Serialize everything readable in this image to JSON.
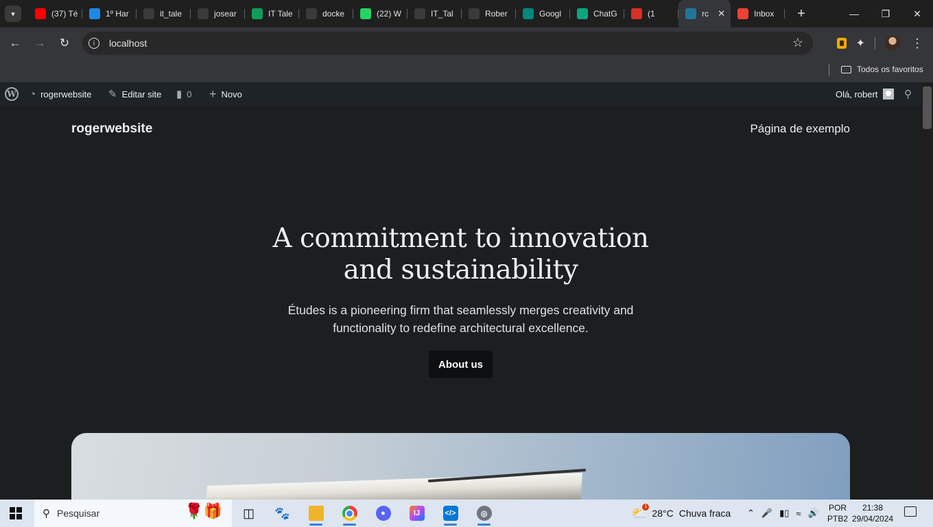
{
  "browser": {
    "tabs": [
      {
        "title": "(37) Té",
        "icon": "youtube-icon",
        "color": "#ff0000"
      },
      {
        "title": "1º Har",
        "icon": "google-classroom-icon",
        "color": "#1e88e5"
      },
      {
        "title": "it_tale",
        "icon": "github-icon",
        "color": "#3a3a3a"
      },
      {
        "title": "josear",
        "icon": "github-icon",
        "color": "#3a3a3a"
      },
      {
        "title": "IT Tale",
        "icon": "google-drive-icon",
        "color": "#0f9d58"
      },
      {
        "title": "docke",
        "icon": "github-icon",
        "color": "#3a3a3a"
      },
      {
        "title": "(22) W",
        "icon": "whatsapp-icon",
        "color": "#25d366"
      },
      {
        "title": "IT_Tal",
        "icon": "github-icon",
        "color": "#3a3a3a"
      },
      {
        "title": "Rober",
        "icon": "github-icon",
        "color": "#3a3a3a"
      },
      {
        "title": "Googl",
        "icon": "google-meet-icon",
        "color": "#00897b"
      },
      {
        "title": "ChatG",
        "icon": "chatgpt-icon",
        "color": "#10a37f"
      },
      {
        "title": "(1",
        "icon": "calendar-icon",
        "color": "#d93025"
      },
      {
        "title": "rc",
        "icon": "wordpress-icon",
        "color": "#21759b",
        "active": true
      },
      {
        "title": "Inbox",
        "icon": "gmail-icon",
        "color": "#ea4335"
      }
    ],
    "url": "localhost",
    "bookmarks_folder": "Todos os favoritos"
  },
  "wp_admin_bar": {
    "site_name": "rogerwebsite",
    "edit_site": "Editar site",
    "comments_count": "0",
    "new": "Novo",
    "greeting": "Olá, robert"
  },
  "site": {
    "title": "rogerwebsite",
    "nav_link": "Página de exemplo",
    "hero_title_line1": "A commitment to innovation",
    "hero_title_line2": "and sustainability",
    "hero_text_line1": "Études is a pioneering firm that seamlessly merges creativity and",
    "hero_text_line2": "functionality to redefine architectural excellence.",
    "cta": "About us"
  },
  "taskbar": {
    "search_placeholder": "Pesquisar",
    "weather_temp": "28°C",
    "weather_desc": "Chuva fraca",
    "weather_badge": "1",
    "lang_top": "POR",
    "lang_bottom": "PTB2",
    "time": "21:38",
    "date": "29/04/2024"
  }
}
